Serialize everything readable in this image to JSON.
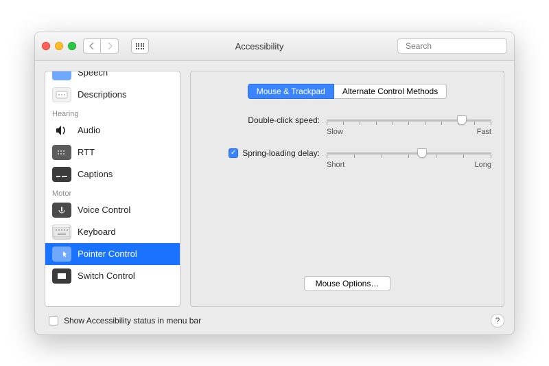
{
  "window": {
    "title": "Accessibility"
  },
  "search": {
    "placeholder": "Search"
  },
  "sidebar": {
    "sections": {
      "hearing_label": "Hearing",
      "motor_label": "Motor"
    },
    "items": {
      "speech": "Speech",
      "descriptions": "Descriptions",
      "audio": "Audio",
      "rtt": "RTT",
      "captions": "Captions",
      "voice_control": "Voice Control",
      "keyboard": "Keyboard",
      "pointer_control": "Pointer Control",
      "switch_control": "Switch Control"
    }
  },
  "tabs": {
    "mouse_trackpad": "Mouse & Trackpad",
    "alt_control": "Alternate Control Methods"
  },
  "settings": {
    "double_click": {
      "label": "Double-click speed:",
      "min_label": "Slow",
      "max_label": "Fast",
      "value_percent": 82
    },
    "spring_loading": {
      "label": "Spring-loading delay:",
      "checked": true,
      "min_label": "Short",
      "max_label": "Long",
      "value_percent": 58
    },
    "mouse_options_label": "Mouse Options…"
  },
  "footer": {
    "show_status_label": "Show Accessibility status in menu bar",
    "show_status_checked": false
  }
}
